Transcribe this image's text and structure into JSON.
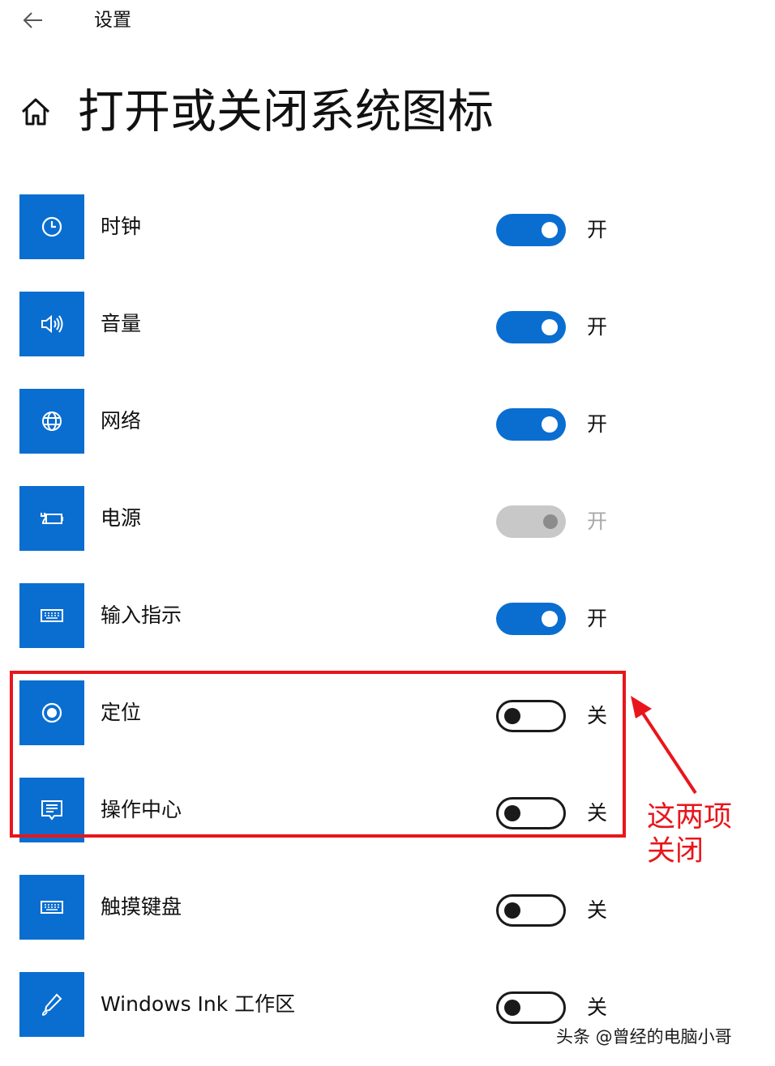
{
  "header": {
    "app_title": "设置",
    "page_title": "打开或关闭系统图标"
  },
  "colors": {
    "accent": "#0a6ed1",
    "annotation_red": "#e8161c",
    "toggle_off_border": "#1a1a1a",
    "toggle_disabled": "#c8c8c8"
  },
  "items": [
    {
      "label": "时钟",
      "icon": "clock-icon",
      "state": "on",
      "state_label": "开"
    },
    {
      "label": "音量",
      "icon": "volume-icon",
      "state": "on",
      "state_label": "开"
    },
    {
      "label": "网络",
      "icon": "globe-icon",
      "state": "on",
      "state_label": "开"
    },
    {
      "label": "电源",
      "icon": "battery-plug-icon",
      "state": "on-disabled",
      "state_label": "开"
    },
    {
      "label": "输入指示",
      "icon": "keyboard-icon",
      "state": "on",
      "state_label": "开"
    },
    {
      "label": "定位",
      "icon": "location-target-icon",
      "state": "off",
      "state_label": "关"
    },
    {
      "label": "操作中心",
      "icon": "action-center-icon",
      "state": "off",
      "state_label": "关"
    },
    {
      "label": "触摸键盘",
      "icon": "keyboard-icon",
      "state": "off",
      "state_label": "关"
    },
    {
      "label": "Windows Ink 工作区",
      "icon": "pen-icon",
      "state": "off",
      "state_label": "关"
    }
  ],
  "annotation": {
    "text": "这两项\n关闭"
  },
  "watermark": "头条 @曾经的电脑小哥"
}
